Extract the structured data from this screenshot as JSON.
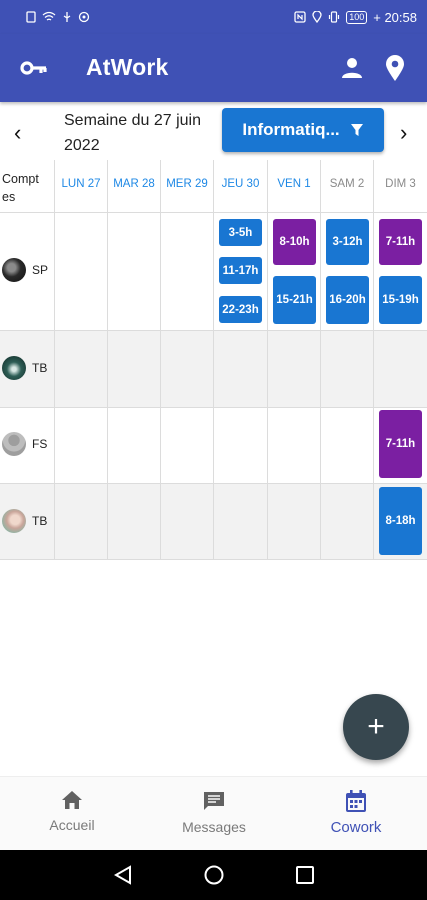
{
  "status_bar": {
    "battery": "100",
    "time": "+ 20:58"
  },
  "app": {
    "title": "AtWork"
  },
  "week": {
    "label": "Semaine du 27 juin 2022",
    "prev": "‹",
    "next": "›"
  },
  "filter": {
    "label": "Informatiq...",
    "icon": "filter-icon"
  },
  "grid": {
    "accounts_header": "Compt es",
    "days": [
      "LUN 27",
      "MAR 28",
      "MER 29",
      "JEU 30",
      "VEN 1",
      "SAM 2",
      "DIM 3"
    ],
    "rows": [
      {
        "initials": "SP",
        "avatar": "dark-photo"
      },
      {
        "initials": "TB",
        "avatar": "teal-photo"
      },
      {
        "initials": "FS",
        "avatar": "grey-placeholder"
      },
      {
        "initials": "TB",
        "avatar": "light-photo"
      }
    ],
    "shifts": {
      "r0_jeu_1": "3-5h",
      "r0_jeu_2": "11-17h",
      "r0_jeu_3": "22-23h",
      "r0_ven_1": "8-10h",
      "r0_ven_2": "15-21h",
      "r0_sam_1": "3-12h",
      "r0_sam_2": "16-20h",
      "r0_dim_1": "7-11h",
      "r0_dim_2": "15-19h",
      "r2_dim_1": "7-11h",
      "r3_dim_1": "8-18h"
    }
  },
  "fab": {
    "label": "+"
  },
  "bottom_nav": {
    "items": [
      {
        "label": "Accueil",
        "icon": "home-icon"
      },
      {
        "label": "Messages",
        "icon": "message-icon"
      },
      {
        "label": "Cowork",
        "icon": "calendar-icon"
      }
    ],
    "active": "Cowork"
  },
  "colors": {
    "primary": "#3f51b5",
    "blue_button": "#1976d2",
    "shift_blue": "#1976d2",
    "shift_purple": "#7b1fa2",
    "fab": "#37474f"
  }
}
